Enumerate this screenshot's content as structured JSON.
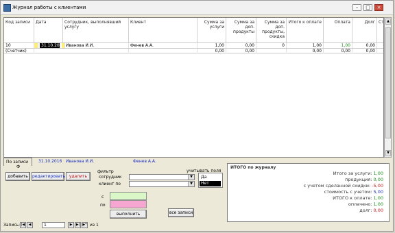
{
  "window": {
    "title": "Журнал работы с клиентами",
    "min": "–",
    "max": "□",
    "close": "×"
  },
  "grid": {
    "columns": [
      "Код записи",
      "Дата",
      "Сотрудник, выполнявший услугу",
      "Клиент",
      "Сумма за услуги",
      "Сумма за доп. продукты",
      "Сумма за доп. продукты, скидка",
      "Итого к оплате",
      "Оплата",
      "Долг",
      "Ст"
    ],
    "rows": [
      {
        "id": "10",
        "date": "31.10.2016",
        "employee": "Иванова И.И.",
        "client": "Фенев А.А.",
        "services": "1,00",
        "extra": "0,00",
        "discount": "0",
        "total": "1,00",
        "payment": "1,00",
        "debt": "0,00"
      },
      {
        "id": "(Счетчик)",
        "date": "",
        "employee": "",
        "client": "",
        "services": "0,00",
        "extra": "0,00",
        "discount": "",
        "total": "0,00",
        "payment": "0,00",
        "debt": "0,00"
      }
    ]
  },
  "tabs": {
    "main_tab": "По записи",
    "tab_sub": "Ф",
    "date": "31.10.2016",
    "employee": "Иванова И.И.",
    "client": "Фенев А.А."
  },
  "buttons": {
    "add": "добавить",
    "edit": "редактировать",
    "delete": "удалить",
    "apply_filter": "выполнить",
    "all_records": "все записи"
  },
  "filter": {
    "heading": "фильтр",
    "row1_label": "сотрудник",
    "row2_label": "клиент по",
    "from_label": "с",
    "to_label": "по",
    "list_label": "учитывать поля",
    "list_items": [
      "Да",
      "Нет"
    ]
  },
  "totals": {
    "heading": "ИТОГО по журналу",
    "lines": [
      {
        "label": "Итого за услуги:",
        "value": "1,00",
        "color": "green"
      },
      {
        "label": "продукция:",
        "value": "0,00",
        "color": "green"
      },
      {
        "label": "с учетом сделанной скидки:",
        "value": "-5,00",
        "color": "red"
      },
      {
        "label": "стоимость с учетом:",
        "value": "5,00",
        "color": "blue"
      },
      {
        "label": "ИТОГО к оплате:",
        "value": "1,00",
        "color": "green"
      },
      {
        "label": "оплачено:",
        "value": "1,00",
        "color": "green"
      },
      {
        "label": "долг:",
        "value": "0,00",
        "color": "red"
      }
    ]
  },
  "navigation": {
    "label": "Запись:",
    "current": "1",
    "of_label": "из 1"
  }
}
